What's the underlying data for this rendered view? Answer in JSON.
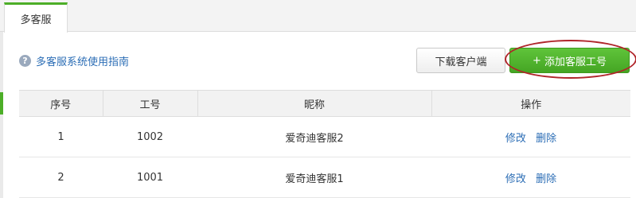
{
  "tabs": [
    {
      "label": "多客服",
      "active": true
    }
  ],
  "guide_link": {
    "icon": "help-circle-icon",
    "label": "多客服系统使用指南"
  },
  "toolbar": {
    "download_label": "下载客户端",
    "add_icon": "+",
    "add_label": "添加客服工号"
  },
  "table": {
    "headers": [
      "序号",
      "工号",
      "昵称",
      "操作"
    ],
    "rows": [
      {
        "index": "1",
        "id": "1002",
        "nickname": "爱奇迪客服2",
        "edit": "修改",
        "delete": "删除"
      },
      {
        "index": "2",
        "id": "1001",
        "nickname": "爱奇迪客服1",
        "edit": "修改",
        "delete": "删除"
      }
    ]
  },
  "colors": {
    "accent_green": "#4cae27",
    "link_blue": "#2b6db5",
    "highlight_red": "#b0252a"
  }
}
